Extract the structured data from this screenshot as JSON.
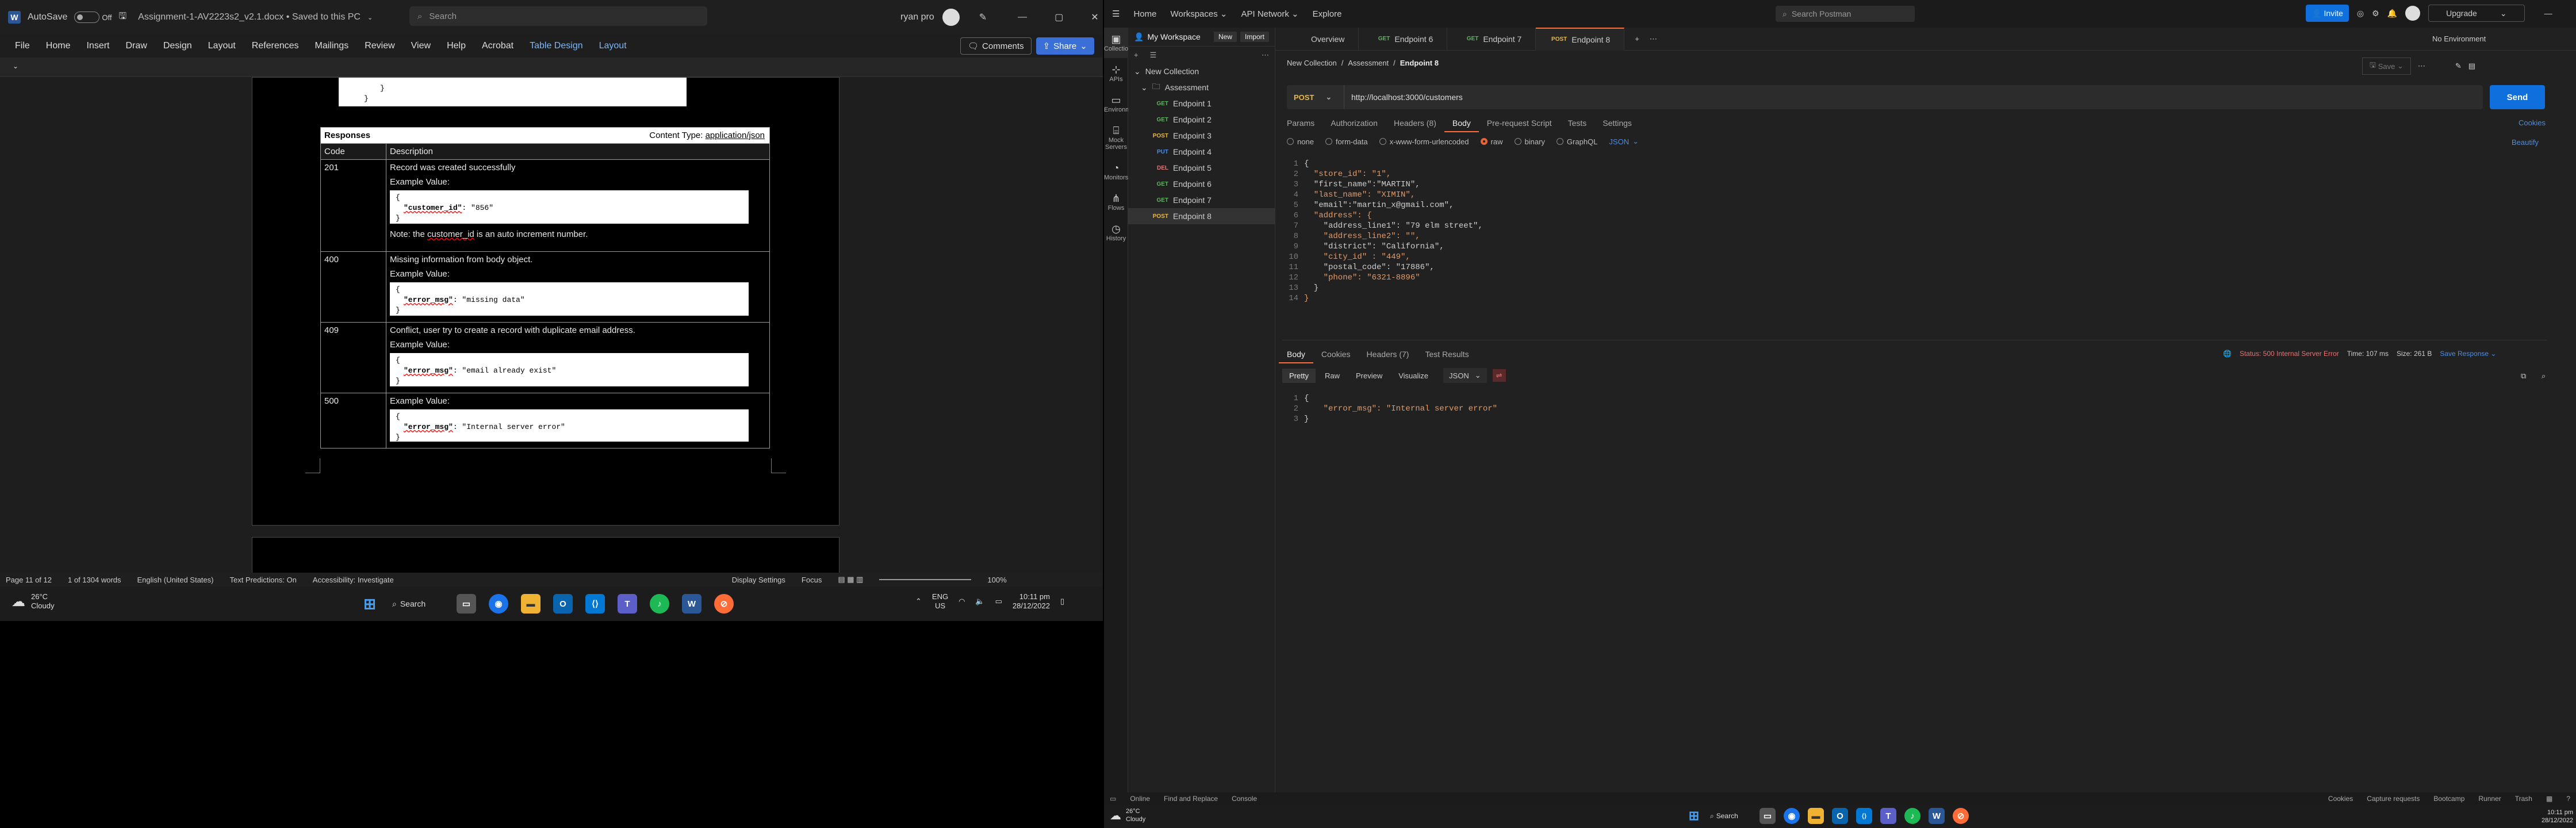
{
  "word": {
    "title_bar": {
      "autosave_label": "AutoSave",
      "autosave_state": "Off",
      "doc_title": "Assignment-1-AV2223s2_v2.1.docx • Saved to this PC",
      "search_placeholder": "Search",
      "user": "ryan pro"
    },
    "menu": [
      "File",
      "Home",
      "Insert",
      "Draw",
      "Design",
      "Layout",
      "References",
      "Mailings",
      "Review",
      "View",
      "Help",
      "Acrobat",
      "Table Design",
      "Layout"
    ],
    "comments_label": "Comments",
    "share_label": "Share",
    "doc": {
      "top_code_close": [
        "}",
        "}"
      ],
      "responses_label": "Responses",
      "content_type_prefix": "Content Type: ",
      "content_type_value": "application/json",
      "col_code": "Code",
      "col_desc": "Description",
      "rows": [
        {
          "code": "201",
          "desc": "Record was created successfully",
          "example": "Example Value:",
          "open": "{",
          "key": "\"customer_id\"",
          "val": ": \"856\"",
          "close": "}",
          "note_pre": "Note: the ",
          "note_key": "customer_id",
          "note_post": " is an auto increment number."
        },
        {
          "code": "400",
          "desc": "Missing information from body object.",
          "example": "Example Value:",
          "open": "{",
          "key": "\"error_msg\"",
          "val": ": \"missing data\"",
          "close": "}"
        },
        {
          "code": "409",
          "desc": "Conflict, user try to create a record with duplicate email address.",
          "example": "Example Value:",
          "open": "{",
          "key": "\"error_msg\"",
          "val": ": \"email already exist\"",
          "close": "}"
        },
        {
          "code": "500",
          "desc": "",
          "example": "Example Value:",
          "open": "{",
          "key": "\"error_msg\"",
          "val": ": \"Internal server error\"",
          "close": "}"
        }
      ]
    },
    "status": {
      "page": "Page 11 of 12",
      "words": "1 of 1304 words",
      "lang": "English (United States)",
      "predictions": "Text Predictions: On",
      "accessibility": "Accessibility: Investigate",
      "display": "Display Settings",
      "focus": "Focus",
      "zoom": "100%"
    }
  },
  "taskbar_left": {
    "weather_temp": "26°C",
    "weather_desc": "Cloudy",
    "search_label": "Search",
    "lang_top": "ENG",
    "lang_bottom": "US",
    "time": "10:11 pm",
    "date": "28/12/2022"
  },
  "postman": {
    "nav": [
      "Home",
      "Workspaces",
      "API Network",
      "Explore"
    ],
    "search_placeholder": "Search Postman",
    "invite": "Invite",
    "upgrade": "Upgrade",
    "env": "No Environment",
    "workspace": "My Workspace",
    "new_btn": "New",
    "import_btn": "Import",
    "rail": [
      "Collections",
      "APIs",
      "Environments",
      "Mock Servers",
      "Monitors",
      "Flows",
      "History"
    ],
    "collection": "New Collection",
    "folder": "Assessment",
    "endpoints": [
      {
        "method": "GET",
        "name": "Endpoint 1",
        "cls": "get"
      },
      {
        "method": "GET",
        "name": "Endpoint 2",
        "cls": "get"
      },
      {
        "method": "POST",
        "name": "Endpoint 3",
        "cls": "post"
      },
      {
        "method": "PUT",
        "name": "Endpoint 4",
        "cls": "put"
      },
      {
        "method": "DEL",
        "name": "Endpoint 5",
        "cls": "del"
      },
      {
        "method": "GET",
        "name": "Endpoint 6",
        "cls": "get"
      },
      {
        "method": "GET",
        "name": "Endpoint 7",
        "cls": "get"
      },
      {
        "method": "POST",
        "name": "Endpoint 8",
        "cls": "post"
      }
    ],
    "tabs": [
      {
        "method": "",
        "name": "Overview",
        "cls": ""
      },
      {
        "method": "GET",
        "name": "Endpoint 6",
        "cls": "get"
      },
      {
        "method": "GET",
        "name": "Endpoint 7",
        "cls": "get"
      },
      {
        "method": "POST",
        "name": "Endpoint 8",
        "cls": "post"
      }
    ],
    "breadcrumb": [
      "New Collection",
      "Assessment",
      "Endpoint 8"
    ],
    "save": "Save",
    "method": "POST",
    "url": "http://localhost:3000/customers",
    "send": "Send",
    "req_tabs": [
      "Params",
      "Authorization",
      "Headers (8)",
      "Body",
      "Pre-request Script",
      "Tests",
      "Settings"
    ],
    "cookies": "Cookies",
    "beautify": "Beautify",
    "body_types": [
      "none",
      "form-data",
      "x-www-form-urlencoded",
      "raw",
      "binary",
      "GraphQL"
    ],
    "body_format": "JSON",
    "req_body": [
      "{",
      "  \"store_id\": \"1\",",
      "  \"first_name\":\"MARTIN\",",
      "  \"last_name\": \"XIMIN\",",
      "  \"email\":\"martin_x@gmail.com\",",
      "  \"address\": {",
      "    \"address_line1\": \"79 elm street\",",
      "    \"address_line2\": \"\",",
      "    \"district\": \"California\",",
      "    \"city_id\" : \"449\",",
      "    \"postal_code\": \"17886\",",
      "    \"phone\": \"6321-8896\"",
      "  }",
      "}"
    ],
    "resp_tabs": [
      "Body",
      "Cookies",
      "Headers (7)",
      "Test Results"
    ],
    "status": "Status: 500 Internal Server Error",
    "time": "Time: 107 ms",
    "size": "Size: 261 B",
    "save_response": "Save Response",
    "view_modes": [
      "Pretty",
      "Raw",
      "Preview",
      "Visualize"
    ],
    "resp_format": "JSON",
    "resp_body": [
      "{",
      "    \"error_msg\": \"Internal server error\"",
      "}"
    ],
    "footer": [
      "Online",
      "Find and Replace",
      "Console"
    ],
    "footer_right": [
      "Cookies",
      "Capture requests",
      "Bootcamp",
      "Runner",
      "Trash"
    ]
  },
  "taskbar_right": {
    "weather_temp": "26°C",
    "weather_desc": "Cloudy",
    "search_label": "Search",
    "time": "10:11 pm",
    "date": "28/12/2022"
  }
}
